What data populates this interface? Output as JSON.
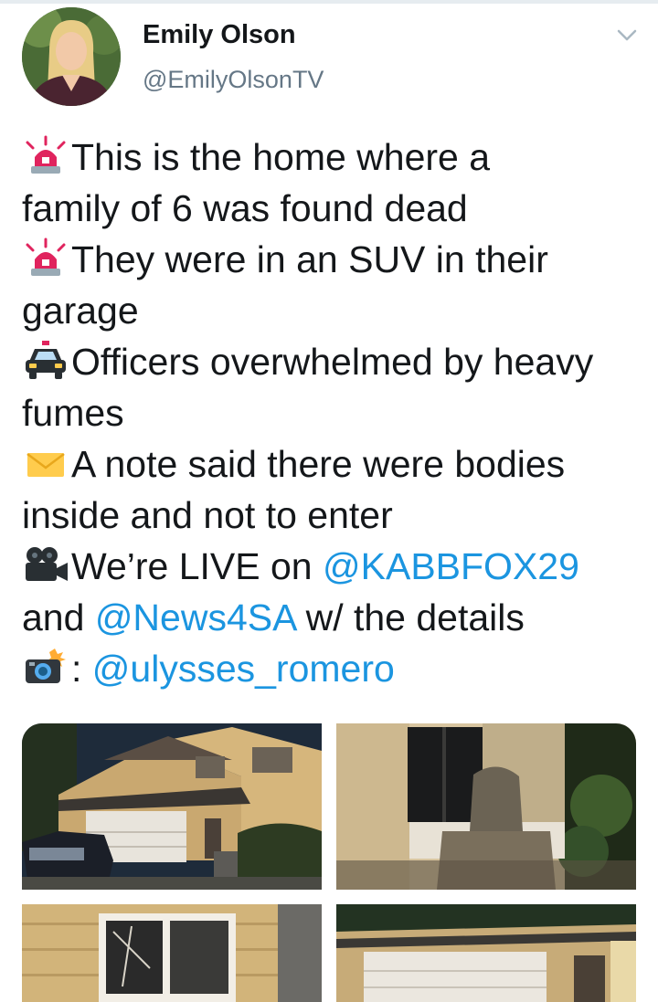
{
  "tweet": {
    "author_name": "Emily Olson",
    "author_handle": "@EmilyOlsonTV",
    "lines": {
      "l1": "This is the home where a",
      "l2": "family of 6 was found dead",
      "l3": "They were in an SUV in their",
      "l4": "garage",
      "l5": "Officers overwhelmed by heavy",
      "l6": "fumes",
      "l7": "A note said there were bodies",
      "l8": "inside and not to enter",
      "l9_text": "We’re LIVE on ",
      "l9_mention": "@KABBFOX29",
      "l10_text1": "and ",
      "l10_mention": "@News4SA",
      "l10_text2": " w/ the details",
      "l11_text": ": ",
      "l11_mention": "@ulysses_romero"
    },
    "icons": {
      "menu": "chevron-down-icon",
      "siren": "police-siren-icon",
      "car": "police-car-icon",
      "mail": "envelope-icon",
      "video": "video-camera-icon",
      "photo": "camera-with-flash-icon"
    },
    "colors": {
      "link": "#1b95e0",
      "text": "#14171a",
      "secondary": "#657786"
    },
    "media": {
      "count": 4,
      "descriptions": [
        "house-front-night",
        "open-door-with-chair",
        "broken-window",
        "garage-door"
      ]
    }
  }
}
